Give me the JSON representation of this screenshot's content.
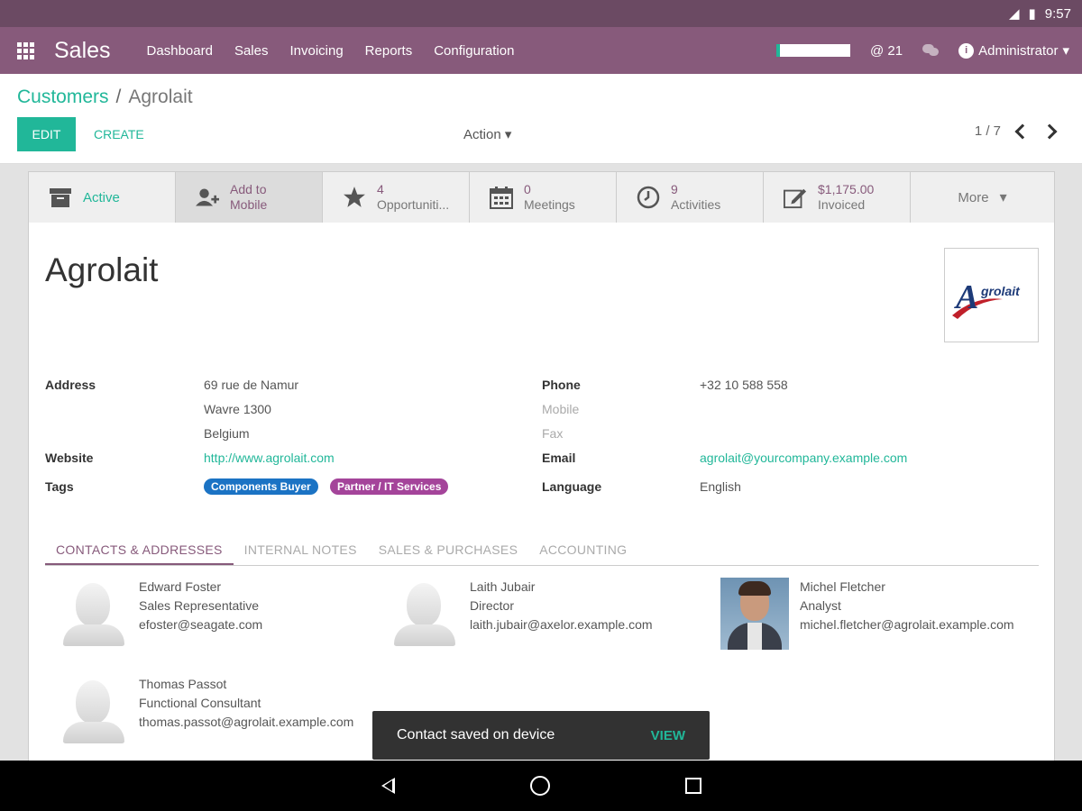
{
  "status_bar": {
    "time": "9:57"
  },
  "nav": {
    "app_title": "Sales",
    "menu": [
      "Dashboard",
      "Sales",
      "Invoicing",
      "Reports",
      "Configuration"
    ],
    "notifications": "21",
    "user": "Administrator"
  },
  "breadcrumb": {
    "parent": "Customers",
    "separator": "/",
    "current": "Agrolait"
  },
  "toolbar": {
    "edit_label": "EDIT",
    "create_label": "CREATE",
    "action_label": "Action",
    "pager": "1 / 7"
  },
  "smart_buttons": {
    "active": "Active",
    "add_mobile_1": "Add to",
    "add_mobile_2": "Mobile",
    "opp_value": "4",
    "opp_label": "Opportuniti...",
    "meet_value": "0",
    "meet_label": "Meetings",
    "act_value": "9",
    "act_label": "Activities",
    "inv_value": "$1,175.00",
    "inv_label": "Invoiced",
    "more": "More"
  },
  "partner": {
    "name": "Agrolait",
    "logo_text": "grolait",
    "address_label": "Address",
    "street": "69 rue de Namur",
    "city": "Wavre  1300",
    "country": "Belgium",
    "website_label": "Website",
    "website": "http://www.agrolait.com",
    "tags_label": "Tags",
    "tags": [
      "Components Buyer",
      "Partner / IT Services"
    ],
    "phone_label": "Phone",
    "phone": "+32 10 588 558",
    "mobile_label": "Mobile",
    "fax_label": "Fax",
    "email_label": "Email",
    "email": "agrolait@yourcompany.example.com",
    "language_label": "Language",
    "language": "English"
  },
  "colors": {
    "brand": "#875a7b",
    "accent": "#21b799",
    "tag_blue": "#1b73c4",
    "tag_purple": "#a4449a"
  },
  "tabs": [
    "CONTACTS & ADDRESSES",
    "INTERNAL NOTES",
    "SALES & PURCHASES",
    "ACCOUNTING"
  ],
  "contacts": [
    {
      "name": "Edward Foster",
      "title": "Sales Representative",
      "email": "efoster@seagate.com"
    },
    {
      "name": "Laith Jubair",
      "title": "Director",
      "email": "laith.jubair@axelor.example.com"
    },
    {
      "name": "Michel Fletcher",
      "title": "Analyst",
      "email": "michel.fletcher@agrolait.example.com"
    },
    {
      "name": "Thomas Passot",
      "title": "Functional Consultant",
      "email": "thomas.passot@agrolait.example.com"
    }
  ],
  "toast": {
    "message": "Contact saved on device",
    "action": "VIEW"
  }
}
